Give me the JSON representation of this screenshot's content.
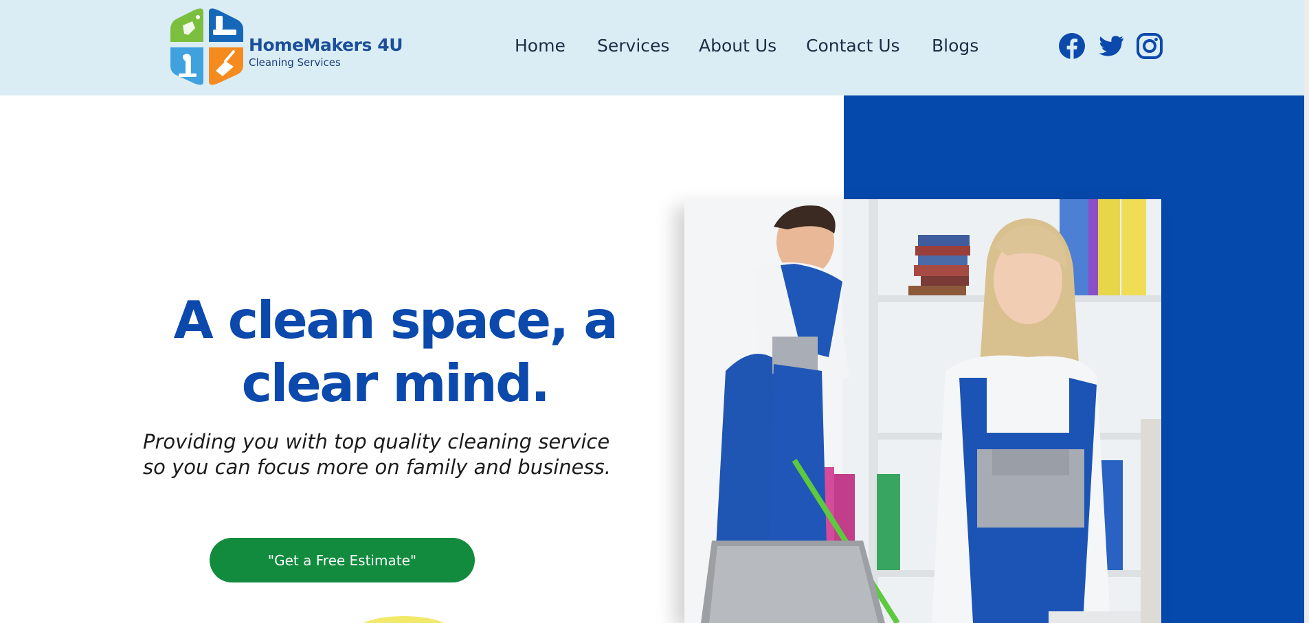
{
  "brand": {
    "name": "HomeMakers 4U",
    "tagline": "Cleaning Services",
    "colors": {
      "green": "#7cbf3f",
      "blue": "#1667b8",
      "light_blue": "#3fa1dd",
      "orange": "#f58b1f"
    }
  },
  "nav": {
    "items": [
      {
        "label": "Home"
      },
      {
        "label": "Services"
      },
      {
        "label": "About Us"
      },
      {
        "label": "Contact Us"
      },
      {
        "label": "Blogs"
      }
    ]
  },
  "social": {
    "items": [
      {
        "icon": "facebook-icon"
      },
      {
        "icon": "twitter-icon"
      },
      {
        "icon": "instagram-icon"
      }
    ],
    "color": "#0b49ac"
  },
  "hero": {
    "title_line1": "A clean space, a",
    "title_line2": "clear mind.",
    "subtitle_line1": "Providing you with top quality cleaning service",
    "subtitle_line2": "so you can focus more on family and business.",
    "cta_label": "\"Get a Free Estimate\""
  },
  "theme": {
    "header_bg": "#dbedf4",
    "accent_blue": "#0649ad",
    "cta_green": "#128b3e"
  }
}
